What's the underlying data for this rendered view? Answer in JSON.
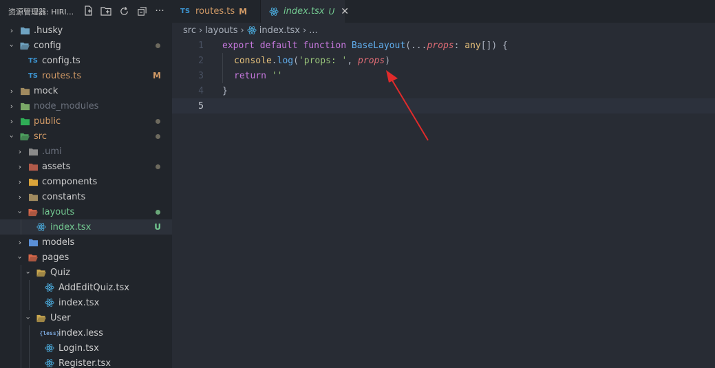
{
  "sidebar": {
    "title": "资源管理器: HIRI...",
    "tree": [
      {
        "label": "husky",
        "prefix": ".",
        "chev": "›",
        "color": "#cccccc",
        "icon": "folder-icon",
        "dot": null,
        "badge": null
      },
      {
        "label": "config",
        "prefix": "",
        "chev": "⌄",
        "color": "#cccccc",
        "icon": "folder-open-icon",
        "dot": "gray",
        "badge": null
      },
      {
        "label": "config.ts",
        "prefix": "",
        "chev": "",
        "color": "#cccccc",
        "icon": "ts-file-icon",
        "dot": null,
        "badge": null
      },
      {
        "label": "routes.ts",
        "prefix": "",
        "chev": "",
        "color": "#d19a66",
        "icon": "ts-file-icon",
        "dot": null,
        "badge": "M"
      },
      {
        "label": "mock",
        "prefix": "",
        "chev": "›",
        "color": "#cccccc",
        "icon": "folder-icon",
        "dot": null,
        "badge": null
      },
      {
        "label": "node_modules",
        "prefix": "",
        "chev": "›",
        "color": "#6b717d",
        "icon": "folder-icon",
        "dot": null,
        "badge": null
      },
      {
        "label": "public",
        "prefix": "",
        "chev": "›",
        "color": "#d19a66",
        "icon": "folder-icon",
        "dot": "gray",
        "badge": null
      },
      {
        "label": "src",
        "prefix": "",
        "chev": "⌄",
        "color": "#d19a66",
        "icon": "folder-open-icon",
        "dot": "gray",
        "badge": null
      },
      {
        "label": "umi",
        "prefix": ".",
        "chev": "›",
        "color": "#6b717d",
        "icon": "folder-icon",
        "dot": null,
        "badge": null
      },
      {
        "label": "assets",
        "prefix": "",
        "chev": "›",
        "color": "#cccccc",
        "icon": "folder-icon",
        "dot": "gray",
        "badge": null
      },
      {
        "label": "components",
        "prefix": "",
        "chev": "›",
        "color": "#cccccc",
        "icon": "folder-icon",
        "dot": null,
        "badge": null
      },
      {
        "label": "constants",
        "prefix": "",
        "chev": "›",
        "color": "#cccccc",
        "icon": "folder-icon",
        "dot": null,
        "badge": null
      },
      {
        "label": "layouts",
        "prefix": "",
        "chev": "⌄",
        "color": "#73c991",
        "icon": "folder-open-icon",
        "dot": "green",
        "badge": null
      },
      {
        "label": "index.tsx",
        "prefix": "",
        "chev": "",
        "color": "#73c991",
        "icon": "react-icon",
        "dot": null,
        "badge": "U"
      },
      {
        "label": "models",
        "prefix": "",
        "chev": "›",
        "color": "#cccccc",
        "icon": "folder-icon",
        "dot": null,
        "badge": null
      },
      {
        "label": "pages",
        "prefix": "",
        "chev": "⌄",
        "color": "#cccccc",
        "icon": "folder-open-icon",
        "dot": null,
        "badge": null
      },
      {
        "label": "Quiz",
        "prefix": "",
        "chev": "⌄",
        "color": "#cccccc",
        "icon": "folder-open-icon",
        "dot": null,
        "badge": null
      },
      {
        "label": "AddEditQuiz.tsx",
        "prefix": "",
        "chev": "",
        "color": "#cccccc",
        "icon": "react-icon",
        "dot": null,
        "badge": null
      },
      {
        "label": "index.tsx",
        "prefix": "",
        "chev": "",
        "color": "#cccccc",
        "icon": "react-icon",
        "dot": null,
        "badge": null
      },
      {
        "label": "User",
        "prefix": "",
        "chev": "⌄",
        "color": "#cccccc",
        "icon": "folder-open-icon",
        "dot": null,
        "badge": null
      },
      {
        "label": "index.less",
        "prefix": "",
        "chev": "",
        "color": "#cccccc",
        "icon": "less-file-icon",
        "dot": null,
        "badge": null
      },
      {
        "label": "Login.tsx",
        "prefix": "",
        "chev": "",
        "color": "#cccccc",
        "icon": "react-icon",
        "dot": null,
        "badge": null
      },
      {
        "label": "Register.tsx",
        "prefix": "",
        "chev": "",
        "color": "#cccccc",
        "icon": "react-icon",
        "dot": null,
        "badge": null
      }
    ]
  },
  "tabs": [
    {
      "label": "routes.ts",
      "badge": "M",
      "icon": "ts-file-icon"
    },
    {
      "label": "index.tsx",
      "badge": "U",
      "icon": "react-icon"
    }
  ],
  "breadcrumb": [
    "src",
    "layouts",
    "index.tsx",
    "..."
  ],
  "editor": {
    "line_numbers": [
      "1",
      "2",
      "3",
      "4",
      "5"
    ],
    "code": {
      "l1_kw1": "export",
      "l1_kw2": "default",
      "l1_kw3": "function",
      "l1_fn": "BaseLayout",
      "l1_p1": "(...",
      "l1_param": "props",
      "l1_p2": ": ",
      "l1_type": "any",
      "l1_p3": "[]) {",
      "l2_obj": "console",
      "l2_dot": ".",
      "l2_fn": "log",
      "l2_p1": "(",
      "l2_str": "'props: '",
      "l2_p2": ", ",
      "l2_param": "props",
      "l2_p3": ")",
      "l3_kw": "return",
      "l3_str": "''",
      "l4": "}"
    }
  }
}
